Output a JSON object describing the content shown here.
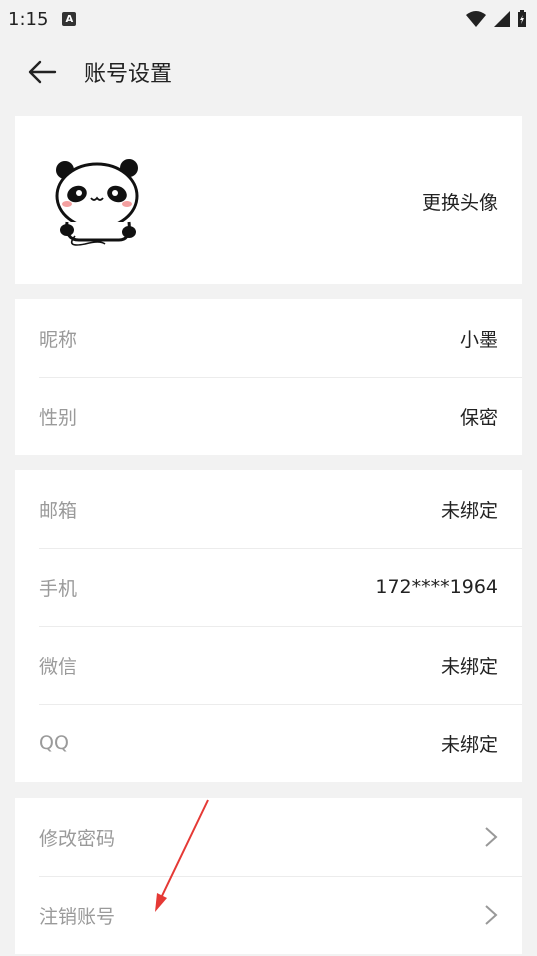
{
  "status_bar": {
    "time": "1:15",
    "notification_badge": "A",
    "icons": [
      "wifi-icon",
      "cell-signal-icon",
      "battery-icon"
    ]
  },
  "header": {
    "back_icon": "arrow-left-icon",
    "title": "账号设置"
  },
  "avatar_section": {
    "change_label": "更换头像"
  },
  "profile": [
    {
      "label": "昵称",
      "value": "小墨"
    },
    {
      "label": "性别",
      "value": "保密"
    }
  ],
  "bindings": [
    {
      "label": "邮箱",
      "value": "未绑定"
    },
    {
      "label": "手机",
      "value": "172****1964"
    },
    {
      "label": "微信",
      "value": "未绑定"
    },
    {
      "label": "QQ",
      "value": "未绑定"
    }
  ],
  "security": [
    {
      "label": "修改密码",
      "icon": "chevron-right-icon"
    },
    {
      "label": "注销账号",
      "icon": "chevron-right-icon"
    }
  ],
  "colors": {
    "background": "#f2f2f2",
    "card": "#ffffff",
    "label": "#9a9a9a",
    "value": "#222222",
    "annotation_arrow": "#e53935"
  }
}
